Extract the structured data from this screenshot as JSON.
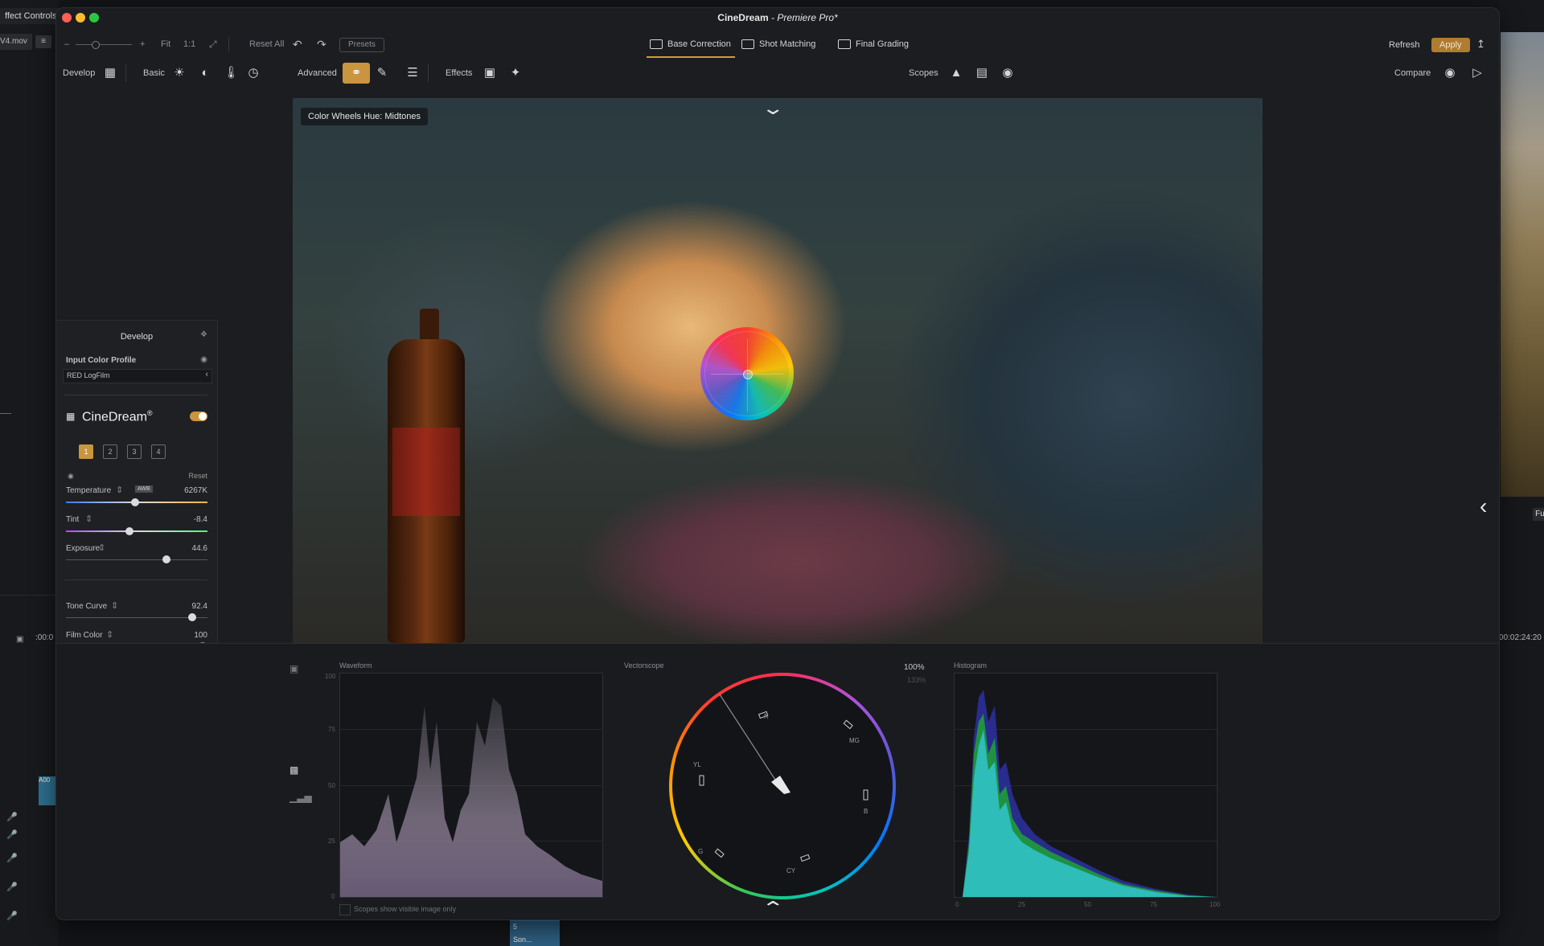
{
  "host": {
    "left_tab": "ffect Controls",
    "file": "V4.mov",
    "timecode_left": ":00:0",
    "timecode_right": "00:02:24:20",
    "clip_a": "A00",
    "clip_b_num": "5",
    "clip_b_label": "Son...",
    "fu_label": "Fu"
  },
  "window": {
    "title": "CineDream",
    "title_suffix": " - Premiere Pro*"
  },
  "toprow": {
    "minus": "–",
    "plus": "+",
    "fit": "Fit",
    "one_to_one": "1:1",
    "reset_all": "Reset All",
    "presets": "Presets",
    "tabs": [
      {
        "label": "Base Correction"
      },
      {
        "label": "Shot Matching"
      },
      {
        "label": "Final Grading"
      }
    ],
    "refresh": "Refresh",
    "apply": "Apply"
  },
  "toolbar": {
    "develop": "Develop",
    "basic": "Basic",
    "advanced": "Advanced",
    "effects": "Effects",
    "scopes": "Scopes",
    "compare": "Compare"
  },
  "viewer": {
    "tag": "Color Wheels Hue: Midtones"
  },
  "develop_panel": {
    "title": "Develop",
    "input_color_profile": "Input Color Profile",
    "profile_value": "RED LogFilm",
    "brand": "CineDream",
    "brand_mark": "®",
    "slots": [
      "1",
      "2",
      "3",
      "4"
    ],
    "reset": "Reset",
    "sliders": [
      {
        "label": "Temperature",
        "value": "6267K",
        "badge": "AWB",
        "level": 0.49
      },
      {
        "label": "Tint",
        "value": "-8.4",
        "level": 0.45
      },
      {
        "label": "Exposure",
        "value": "44.6",
        "level": 0.71
      },
      {
        "label": "Tone Curve",
        "value": "92.4",
        "level": 0.89
      },
      {
        "label": "Film Color",
        "value": "100",
        "level": 0.96
      }
    ]
  },
  "scopes": {
    "waveform": {
      "title": "Waveform",
      "ticks": [
        "100",
        "75",
        "50",
        "25",
        "0"
      ]
    },
    "vectorscope": {
      "title": "Vectorscope",
      "zoom_a": "100%",
      "zoom_b": "133%",
      "targets": [
        "R",
        "MG",
        "B",
        "CY",
        "G",
        "YL"
      ]
    },
    "histogram": {
      "title": "Histogram",
      "ticks": [
        "0",
        "25",
        "50",
        "75",
        "100"
      ]
    },
    "visible_only": "Scopes show visible image only"
  },
  "colors": {
    "accent": "#c9953e",
    "apply_bg": "#b07c2f",
    "panel_bg": "#1c1d20"
  }
}
